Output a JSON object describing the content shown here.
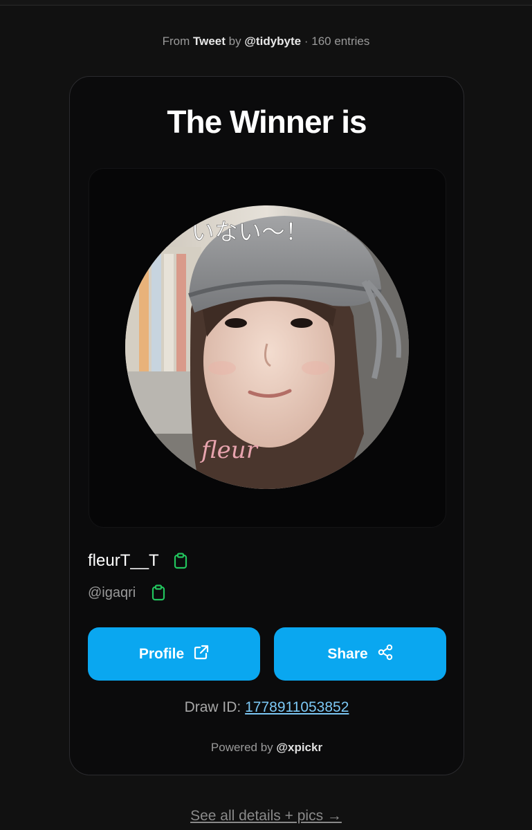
{
  "source": {
    "prefix": "From",
    "type": "Tweet",
    "by": "by",
    "author": "@tidybyte",
    "separator": "·",
    "entries": "160 entries"
  },
  "card": {
    "heading": "The Winner is",
    "photo_text_top": "いない～！",
    "photo_signature": "fleur",
    "winner_name": "fleurT__T",
    "winner_handle": "@igaqri",
    "profile_button": "Profile",
    "share_button": "Share",
    "draw_id_label": "Draw ID:",
    "draw_id_value": "1778911053852",
    "powered_prefix": "Powered by",
    "powered_brand": "@xpickr"
  },
  "footer": {
    "details_link": "See all details + pics →"
  },
  "colors": {
    "background": "#111111",
    "card": "#0b0b0c",
    "accent_button": "#0aa7f0",
    "copy_icon": "#22c55e",
    "link": "#7cc8f5"
  },
  "icons": {
    "name_copy": "clipboard-icon",
    "handle_copy": "clipboard-icon",
    "profile": "external-link-icon",
    "share": "share-icon"
  }
}
